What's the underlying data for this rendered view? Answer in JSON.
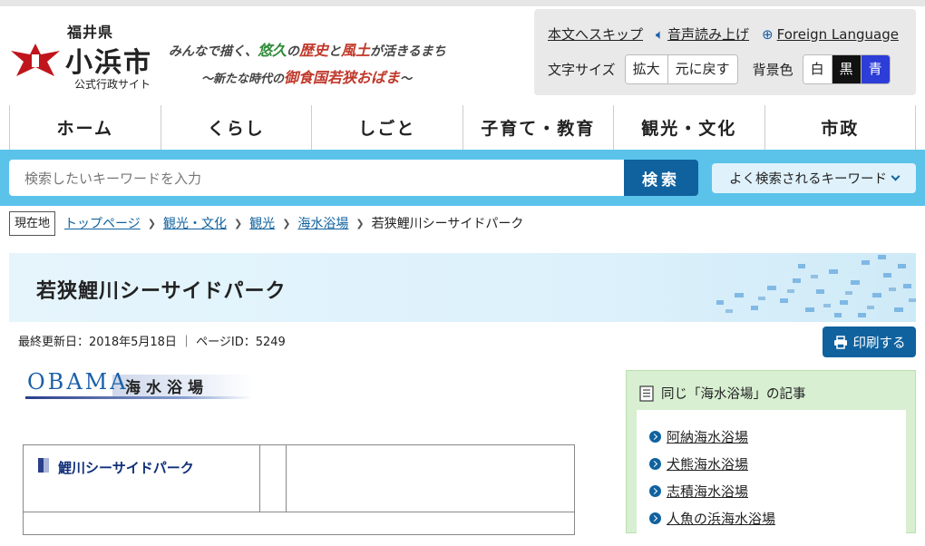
{
  "header": {
    "prefecture": "福井県",
    "city": "小浜市",
    "subtitle": "公式行政サイト",
    "tagline_parts": [
      "みんなで描く、",
      "悠久",
      "の",
      "歴史",
      "と",
      "風土",
      "が活きるまち"
    ],
    "tagline_line2_parts": [
      "〜新たな時代の",
      "御食国若狭おばま",
      "〜"
    ]
  },
  "util": {
    "skip": "本文へスキップ",
    "read_aloud": "音声読み上げ",
    "foreign": "Foreign Language",
    "text_size_label": "文字サイズ",
    "enlarge": "拡大",
    "reset": "元に戻す",
    "bg_label": "背景色",
    "bg_white": "白",
    "bg_black": "黒",
    "bg_blue": "青"
  },
  "nav": {
    "items": [
      {
        "label": "ホーム"
      },
      {
        "label": "くらし"
      },
      {
        "label": "しごと"
      },
      {
        "label": "子育て・教育"
      },
      {
        "label": "観光・文化"
      },
      {
        "label": "市政"
      }
    ]
  },
  "search": {
    "placeholder": "検索したいキーワードを入力",
    "button": "検索",
    "keywords": "よく検索されるキーワード"
  },
  "breadcrumb": {
    "here": "現在地",
    "items": [
      {
        "label": "トップページ"
      },
      {
        "label": "観光・文化"
      },
      {
        "label": "観光"
      },
      {
        "label": "海水浴場"
      }
    ],
    "current": "若狭鯉川シーサイドパーク"
  },
  "page": {
    "title": "若狭鯉川シーサイドパーク",
    "meta": "最終更新日：2018年5月18日 ｜ ページID：5249",
    "print": "印刷する",
    "banner_logo": "OBAMA",
    "banner_title": "海水浴場",
    "table_heading": "鯉川シーサイドパーク"
  },
  "sidebar": {
    "heading": "同じ「海水浴場」の記事",
    "items": [
      {
        "label": "阿納海水浴場"
      },
      {
        "label": "犬熊海水浴場"
      },
      {
        "label": "志積海水浴場"
      },
      {
        "label": "人魚の浜海水浴場"
      }
    ]
  },
  "colors": {
    "accent": "#10629f",
    "search_band": "#5bc3ea",
    "sidebar_bg": "#d8efd2"
  }
}
